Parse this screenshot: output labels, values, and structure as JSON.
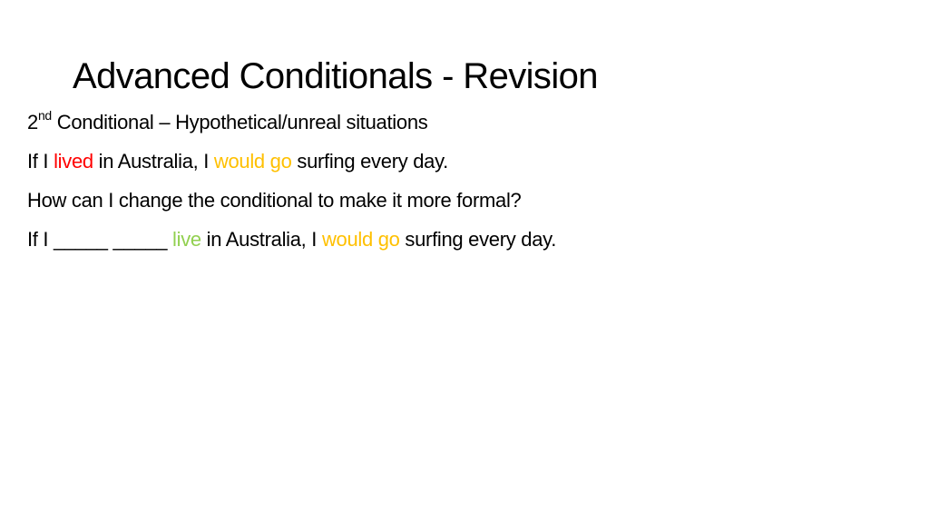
{
  "slide": {
    "title": "Advanced Conditionals - Revision",
    "lines": [
      {
        "ordinal_number": "2",
        "ordinal_suffix": "nd",
        "text": " Conditional – Hypothetical/unreal situations"
      },
      {
        "part1": "If I ",
        "verb_past": "lived",
        "part2": " in Australia, I ",
        "would_go": "would go",
        "part3": " surfing every day."
      },
      {
        "text": "How can I change the conditional to make it more formal?"
      },
      {
        "part1": "If I _____ _____ ",
        "verb_base": "live",
        "part2": " in Australia, I ",
        "would_go": "would go",
        "part3": " surfing every day."
      }
    ],
    "colors": {
      "past_verb": "#ff0000",
      "would_go": "#ffc000",
      "base_verb": "#92d050"
    }
  }
}
